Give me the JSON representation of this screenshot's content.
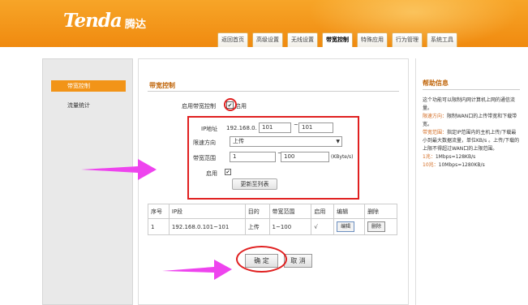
{
  "header": {
    "logo": "Tenda",
    "logo_cn": "腾达",
    "tabs": [
      {
        "label": "返回首页"
      },
      {
        "label": "高级设置"
      },
      {
        "label": "无线设置"
      },
      {
        "label": "带宽控制",
        "active": true
      },
      {
        "label": "特殊应用"
      },
      {
        "label": "行为管理"
      },
      {
        "label": "系统工具"
      }
    ],
    "colors": {
      "bar": "#f29418",
      "tab_border": "#e0b05a"
    }
  },
  "sidebar": {
    "items": [
      {
        "label": "带宽控制",
        "active": true
      },
      {
        "label": "流量统计",
        "active": false
      }
    ]
  },
  "main": {
    "section_title": "带宽控制",
    "enable_label": "启用带宽控制",
    "enable_checked": true,
    "enable_text": "启用",
    "form": {
      "ip_label": "IP地址",
      "ip_prefix": "192.168.0.",
      "ip_start": "101",
      "ip_sep": "~",
      "ip_end": "101",
      "direction_label": "限速方向",
      "direction_value": "上传",
      "range_label": "带宽范围",
      "range_min": "1",
      "range_sep": "~",
      "range_max": "100",
      "range_unit": "(KByte/s)",
      "enable_label": "启用",
      "enable_checked": true,
      "add_button": "更新至列表"
    },
    "table": {
      "headers": [
        "序号",
        "IP段",
        "目的",
        "带宽范围",
        "启用",
        "编辑",
        "删除"
      ],
      "rows": [
        {
          "index": "1",
          "ip": "192.168.0.101~101",
          "dest": "上传",
          "range": "1~100",
          "enabled": "√",
          "edit": "编辑",
          "delete": "删除"
        }
      ]
    },
    "ok_button": "确 定",
    "cancel_button": "取 消"
  },
  "help": {
    "title": "帮助信息",
    "intro": "这个功能可以限制内网计算机上网的通信流量。",
    "dir_key": "限速方向：",
    "dir_text": "限制WAN口的上传带宽和下载带宽。",
    "range_key": "带宽范围：",
    "range_text": "指定IP范围内的主机上传/下载最小到最大数据流量，单位KB/s 。上传/下载的上限不得超过WAN口的上限范围。",
    "note1_key": "1兆：",
    "note1_text": "1Mbps=128KB/s",
    "note2_key": "10兆：",
    "note2_text": "10Mbps=1280KB/s"
  },
  "annotations": {
    "highlight_color": "#e02020",
    "arrow_color": "#ee44ee"
  }
}
